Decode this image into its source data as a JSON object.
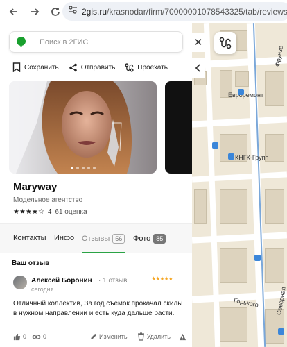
{
  "browser": {
    "url_domain": "2gis.ru",
    "url_path": "/krasnodar/firm/70000001078543325/tab/reviews"
  },
  "search": {
    "placeholder": "Поиск в 2ГИС"
  },
  "actions": {
    "save": "Сохранить",
    "share": "Отправить",
    "route": "Проехать"
  },
  "firm": {
    "name": "Maryway",
    "category": "Модельное агентство",
    "rating": "4",
    "stars": "★★★★☆",
    "rating_count": "61 оценка",
    "photo_count_dots": 5
  },
  "tabs": [
    {
      "label": "Контакты"
    },
    {
      "label": "Инфо"
    },
    {
      "label": "Отзывы",
      "badge": "56"
    },
    {
      "label": "Фото",
      "badge": "85"
    }
  ],
  "review_section": {
    "title": "Ваш отзыв",
    "author": "Алексей Боронин",
    "reviews_count": "1 отзыв",
    "date": "сегодня",
    "stars": "★★★★★",
    "text": "Отличный коллектив, За год съемок прокачал скилы в нужном направлении и есть куда дальше расти.",
    "likes": "0",
    "views": "0",
    "edit": "Изменить",
    "delete": "Удалить"
  },
  "map": {
    "labels": {
      "frunze": "Фрунзе",
      "evroremont": "Евроремонт",
      "kngk": "КНГК-Групп",
      "gorkogo": "Горького",
      "severnaya": "Северная"
    }
  },
  "colors": {
    "accent_green": "#2aa345",
    "logo_green": "#19a02e",
    "star_orange": "#f5a623"
  }
}
